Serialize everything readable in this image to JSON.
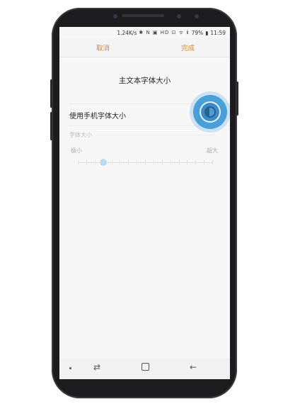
{
  "status_bar": {
    "speed": "1.24K/s",
    "icons": "✱ N ▣ HD ⊡ ᯤ ⅱ",
    "battery": "79%",
    "time": "11:59"
  },
  "header": {
    "cancel_label": "取消",
    "done_label": "完成"
  },
  "main": {
    "title": "主文本字体大小",
    "use_system_font_label": "使用手机字体大小",
    "use_system_font_enabled": true,
    "section_label": "字体大小",
    "slider": {
      "min_label": "极小",
      "max_label": "超大",
      "steps": 16,
      "position": 3
    }
  },
  "colors": {
    "accent": "#e8871e",
    "toggle": "#4a9fd8"
  }
}
